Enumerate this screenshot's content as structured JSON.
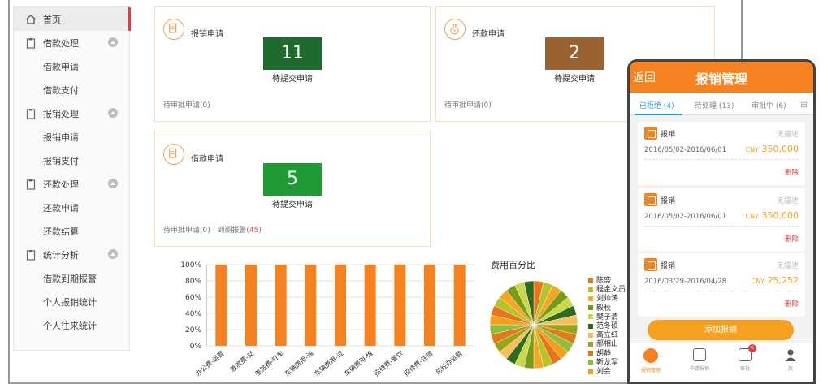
{
  "sidebar": {
    "home": "首页",
    "groups": [
      {
        "label": "借款处理",
        "items": [
          "借款申请",
          "借款支付"
        ]
      },
      {
        "label": "报销处理",
        "items": [
          "报销申请",
          "报销支付"
        ]
      },
      {
        "label": "还款处理",
        "items": [
          "还款申请",
          "还款结算"
        ]
      },
      {
        "label": "统计分析",
        "items": [
          "借款到期报警",
          "个人报销统计",
          "个人往来统计"
        ]
      }
    ]
  },
  "cards": {
    "reimburse": {
      "title": "报销申请",
      "count": "11",
      "count_label": "待提交申请",
      "pending": "待审批申请(0)",
      "color": "#1f6b2d"
    },
    "repay": {
      "title": "还款申请",
      "count": "2",
      "count_label": "待提交申请",
      "pending": "待审批申请(0)",
      "color": "#9a6230"
    },
    "loan": {
      "title": "借款申请",
      "count": "5",
      "count_label": "待提交申请",
      "pending": "待审批申请(0)",
      "due_prefix": "到期报警(",
      "due_count": "45",
      "due_suffix": ")",
      "color": "#1f9a34"
    }
  },
  "chart_data": [
    {
      "type": "bar",
      "categories": [
        "办公费-运营",
        "差旅费-交",
        "差旅费-打车",
        "车辆费用-油",
        "车辆费用-过",
        "车辆费用-维",
        "招待费-餐饮",
        "招待费-住宿",
        "总经办运营"
      ],
      "values": [
        100,
        100,
        100,
        100,
        100,
        100,
        100,
        100,
        100
      ],
      "ylim": [
        0,
        100
      ],
      "yticks": [
        "0%",
        "20%",
        "40%",
        "60%",
        "80%",
        "100%"
      ],
      "title": "",
      "xlabel": "",
      "ylabel": "",
      "color": "#f5821f"
    },
    {
      "type": "pie",
      "title": "费用百分比",
      "legend": [
        "陈盛",
        "程金文员",
        "刘帅涛",
        "毅秋",
        "樊子清",
        "范冬硕",
        "高立红",
        "郝相山",
        "胡静",
        "靳龙军",
        "刘会"
      ],
      "legend_colors": [
        "#e8751a",
        "#b5c42a",
        "#f5a623",
        "#7a9a1a",
        "#c9d84a",
        "#2e6b1e",
        "#f5c05a",
        "#9aa41a",
        "#e07b1a",
        "#8fbf3a",
        "#f2a01a"
      ]
    }
  ],
  "phone": {
    "back": "返回",
    "title": "报销管理",
    "tabs": [
      "已拒绝 (4)",
      "待处理 (13)",
      "审批中 (6)",
      "审"
    ],
    "items": [
      {
        "type": "报销",
        "desc": "无描述",
        "date": "2016/05/02-2016/06/01",
        "currency": "CNY",
        "amount": "350,000",
        "delete": "删除"
      },
      {
        "type": "报销",
        "desc": "无描述",
        "date": "2016/05/02-2016/06/01",
        "currency": "CNY",
        "amount": "350,000",
        "delete": "删除"
      },
      {
        "type": "报销",
        "desc": "无描述",
        "date": "2016/03/29-2016/04/28",
        "currency": "CNY",
        "amount": "25,252",
        "delete": "删除"
      }
    ],
    "add_button": "添加报销",
    "nav": [
      "报销管理",
      "申请报销",
      "审批",
      "我"
    ],
    "nav_badge": "6"
  }
}
